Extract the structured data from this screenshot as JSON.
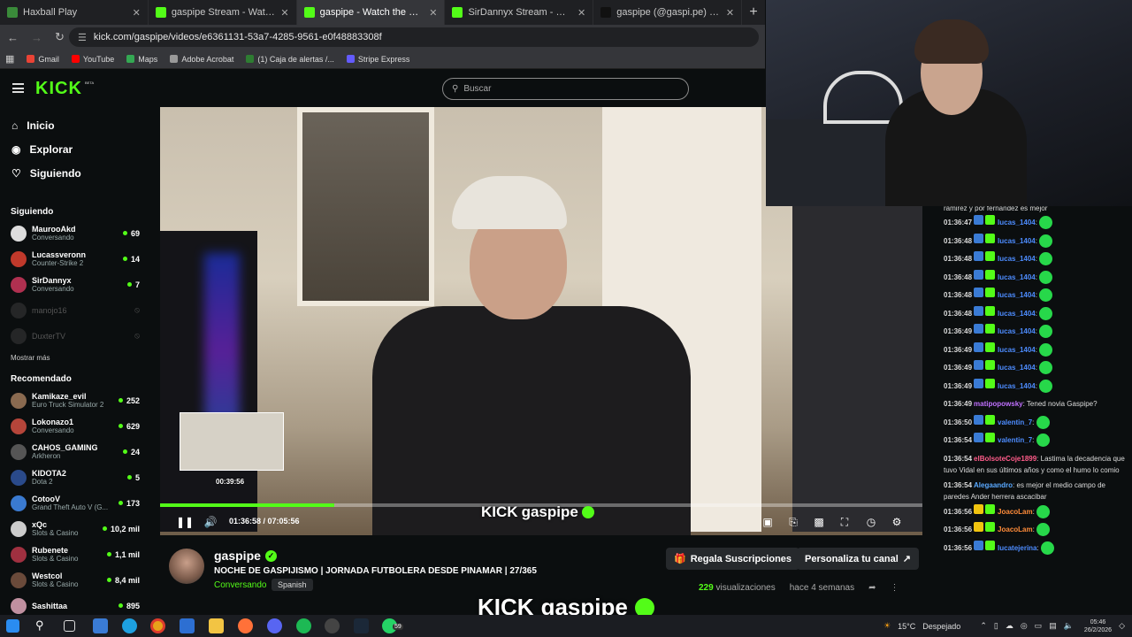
{
  "browser": {
    "tabs": [
      {
        "title": "Haxball Play",
        "color": "#3a8a3a",
        "active": false
      },
      {
        "title": "gaspipe Stream - Watch Live on",
        "color": "#53fc18",
        "active": false
      },
      {
        "title": "gaspipe - Watch the VOD o",
        "color": "#53fc18",
        "active": true
      },
      {
        "title": "SirDannyx Stream - Watch Live",
        "color": "#53fc18",
        "active": false
      },
      {
        "title": "gaspipe (@gaspi.pe) | TikTok",
        "color": "#111111",
        "active": false
      }
    ],
    "new_tab": "+",
    "url": "kick.com/gaspipe/videos/e6361131-53a7-4285-9561-e0f48883308f",
    "bookmarks": [
      {
        "label": "Gmail",
        "color": "#ea4335"
      },
      {
        "label": "YouTube",
        "color": "#ff0000"
      },
      {
        "label": "Maps",
        "color": "#34a853"
      },
      {
        "label": "Adobe Acrobat",
        "color": "#999999"
      },
      {
        "label": "(1) Caja de alertas /...",
        "color": "#2e7d32"
      },
      {
        "label": "Stripe Express",
        "color": "#635bff"
      }
    ]
  },
  "header": {
    "logo": "KICK",
    "beta": "BETA",
    "search_placeholder": "Buscar"
  },
  "sidebar": {
    "nav": [
      {
        "label": "Inicio",
        "icon": "home-icon"
      },
      {
        "label": "Explorar",
        "icon": "compass-icon"
      },
      {
        "label": "Siguiendo",
        "icon": "heart-icon"
      }
    ],
    "following_title": "Siguiendo",
    "following": [
      {
        "name": "MaurooAkd",
        "category": "Conversando",
        "viewers": "69",
        "live": true,
        "color": "#ddd"
      },
      {
        "name": "Lucassveronn",
        "category": "Counter-Strike 2",
        "viewers": "14",
        "live": true,
        "color": "#c0392b"
      },
      {
        "name": "SirDannyx",
        "category": "Conversando",
        "viewers": "7",
        "live": true,
        "color": "#b03050"
      },
      {
        "name": "manojo16",
        "category": "",
        "viewers": "",
        "live": false,
        "color": "#444"
      },
      {
        "name": "DuxterTV",
        "category": "",
        "viewers": "",
        "live": false,
        "color": "#444"
      }
    ],
    "show_more": "Mostrar más",
    "recommended_title": "Recomendado",
    "recommended": [
      {
        "name": "Kamikaze_evil",
        "category": "Euro Truck Simulator 2",
        "viewers": "252",
        "color": "#8a6a50"
      },
      {
        "name": "Lokonazo1",
        "category": "Conversando",
        "viewers": "629",
        "color": "#b5453a"
      },
      {
        "name": "CAHOS_GAMING",
        "category": "Arkheron",
        "viewers": "24",
        "color": "#555"
      },
      {
        "name": "KIDOTA2",
        "category": "Dota 2",
        "viewers": "5",
        "color": "#2a4a8a"
      },
      {
        "name": "CotooV",
        "category": "Grand Theft Auto V (G...",
        "viewers": "173",
        "color": "#3a7ad0"
      },
      {
        "name": "xQc",
        "category": "Slots & Casino",
        "viewers": "10,2 mil",
        "color": "#ccc"
      },
      {
        "name": "Rubenete",
        "category": "Slots & Casino",
        "viewers": "1,1 mil",
        "color": "#a03040"
      },
      {
        "name": "Westcol",
        "category": "Slots & Casino",
        "viewers": "8,4 mil",
        "color": "#6a4a3a"
      },
      {
        "name": "Sashittaa",
        "category": "",
        "viewers": "895",
        "color": "#c090a0"
      }
    ]
  },
  "player": {
    "mini_timestamp": "00:39:56",
    "time": "01:36:58 / 07:05:56",
    "progress": 0.229,
    "watermark": "gaspipe",
    "watermark_kick": "KICK"
  },
  "channel": {
    "name": "gaspipe",
    "title": "NOCHE DE GASPIJISMO | JORNADA FUTBOLERA DESDE PINAMAR | 27/365",
    "category": "Conversando",
    "language": "Spanish",
    "subscribe": "Regala Suscripciones",
    "customize": "Personaliza tu canal",
    "views_count": "229",
    "views_label": "visualizaciones",
    "ago": "hace 4 semanas"
  },
  "chat": {
    "top_fragment": "ramirez y por fernandez es mejor",
    "messages": [
      {
        "t": "01:36:47",
        "user": "lucas_1404",
        "color": "#4d8cff",
        "text": "",
        "emote": true
      },
      {
        "t": "01:36:48",
        "user": "lucas_1404",
        "color": "#4d8cff",
        "text": "",
        "emote": true
      },
      {
        "t": "01:36:48",
        "user": "lucas_1404",
        "color": "#4d8cff",
        "text": "",
        "emote": true
      },
      {
        "t": "01:36:48",
        "user": "lucas_1404",
        "color": "#4d8cff",
        "text": "",
        "emote": true
      },
      {
        "t": "01:36:48",
        "user": "lucas_1404",
        "color": "#4d8cff",
        "text": "",
        "emote": true
      },
      {
        "t": "01:36:48",
        "user": "lucas_1404",
        "color": "#4d8cff",
        "text": "",
        "emote": true
      },
      {
        "t": "01:36:49",
        "user": "lucas_1404",
        "color": "#4d8cff",
        "text": "",
        "emote": true
      },
      {
        "t": "01:36:49",
        "user": "lucas_1404",
        "color": "#4d8cff",
        "text": "",
        "emote": true
      },
      {
        "t": "01:36:49",
        "user": "lucas_1404",
        "color": "#4d8cff",
        "text": "",
        "emote": true
      },
      {
        "t": "01:36:49",
        "user": "lucas_1404",
        "color": "#4d8cff",
        "text": "",
        "emote": true
      },
      {
        "t": "01:36:49",
        "user": "matipopowsky",
        "color": "#c070ff",
        "text": "Tened novia Gaspipe?",
        "emote": false
      },
      {
        "t": "01:36:50",
        "user": "valentin_7",
        "color": "#4d8cff",
        "text": "",
        "emote": true
      },
      {
        "t": "01:36:54",
        "user": "valentin_7",
        "color": "#4d8cff",
        "text": "",
        "emote": true
      },
      {
        "t": "01:36:54",
        "user": "elBolsoteCoje1899",
        "color": "#ff5c8a",
        "text": "Lastima la decadencia que tuvo Vidal en sus últimos años y como el humo lo comio",
        "emote": false
      },
      {
        "t": "01:36:54",
        "user": "Alegaandro",
        "color": "#5aa9ff",
        "text": "es mejor el medio campo de paredes Ander herrera ascacibar",
        "emote": false
      },
      {
        "t": "01:36:56",
        "user": "JoacoLam",
        "color": "#ff8c3a",
        "text": "",
        "emote": true
      },
      {
        "t": "01:36:56",
        "user": "JoacoLam",
        "color": "#ff8c3a",
        "text": "",
        "emote": true
      },
      {
        "t": "01:36:56",
        "user": "lucatejerina",
        "color": "#4d8cff",
        "text": "",
        "emote": true
      }
    ]
  },
  "taskbar": {
    "temperature": "15°C",
    "weather": "Despejado",
    "time": "05:46",
    "date": "26/2/2026",
    "whatsapp_badge": "59"
  },
  "colors": {
    "accent": "#53fc18",
    "background": "#0b0e0f"
  }
}
